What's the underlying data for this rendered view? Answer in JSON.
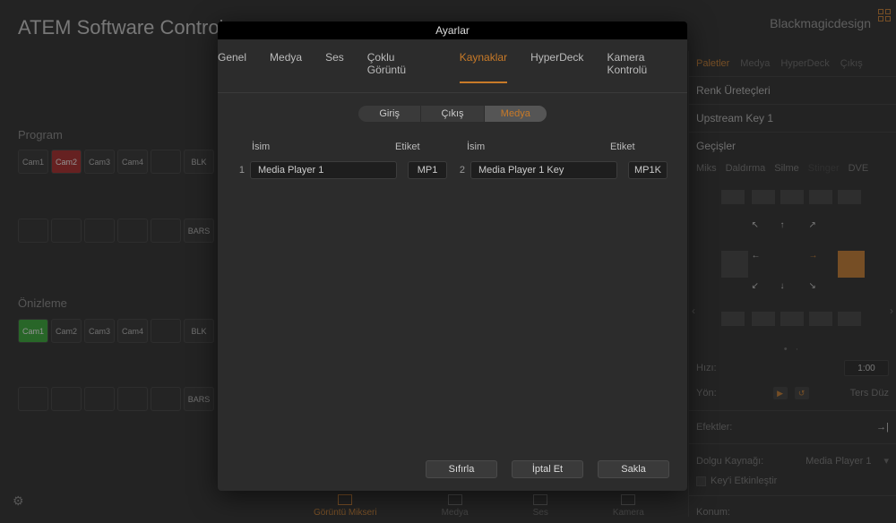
{
  "app": {
    "title": "ATEM Software Control",
    "brand": "Blackmagicdesign"
  },
  "bus": {
    "program_label": "Program",
    "preview_label": "Önizleme",
    "cams": [
      "Cam1",
      "Cam2",
      "Cam3",
      "Cam4"
    ],
    "blk": "BLK",
    "bars": "BARS"
  },
  "right": {
    "tabs": [
      "Paletler",
      "Medya",
      "HyperDeck",
      "Çıkış"
    ],
    "h1": "Renk Üreteçleri",
    "h2": "Upstream Key 1",
    "h3": "Geçişler",
    "trans_opts": [
      "Miks",
      "Daldırma",
      "Silme",
      "Stinger",
      "DVE"
    ],
    "rate_lbl": "Hızı:",
    "rate": "1:00",
    "dir_lbl": "Yön:",
    "reverse": "Ters Düz",
    "effects_lbl": "Efektler:",
    "fill_lbl": "Dolgu Kaynağı:",
    "fill_val": "Media Player 1",
    "pos_lbl": "Konum:"
  },
  "bottom": [
    "Görüntü Mikseri",
    "Medya",
    "Ses",
    "Kamera"
  ],
  "modal": {
    "title": "Ayarlar",
    "tabs": [
      "Genel",
      "Medya",
      "Ses",
      "Çoklu Görüntü",
      "Kaynaklar",
      "HyperDeck",
      "Kamera Kontrolü"
    ],
    "active_tab": "Kaynaklar",
    "segments": [
      "Giriş",
      "Çıkış",
      "Medya"
    ],
    "active_segment": "Medya",
    "col_name": "İsim",
    "col_label": "Etiket",
    "rows": [
      {
        "idx": "1",
        "name": "Media Player 1",
        "label": "MP1"
      },
      {
        "idx": "2",
        "name": "Media Player 1 Key",
        "label": "MP1K"
      }
    ],
    "reset": "Sıfırla",
    "cancel": "İptal Et",
    "save": "Sakla"
  }
}
